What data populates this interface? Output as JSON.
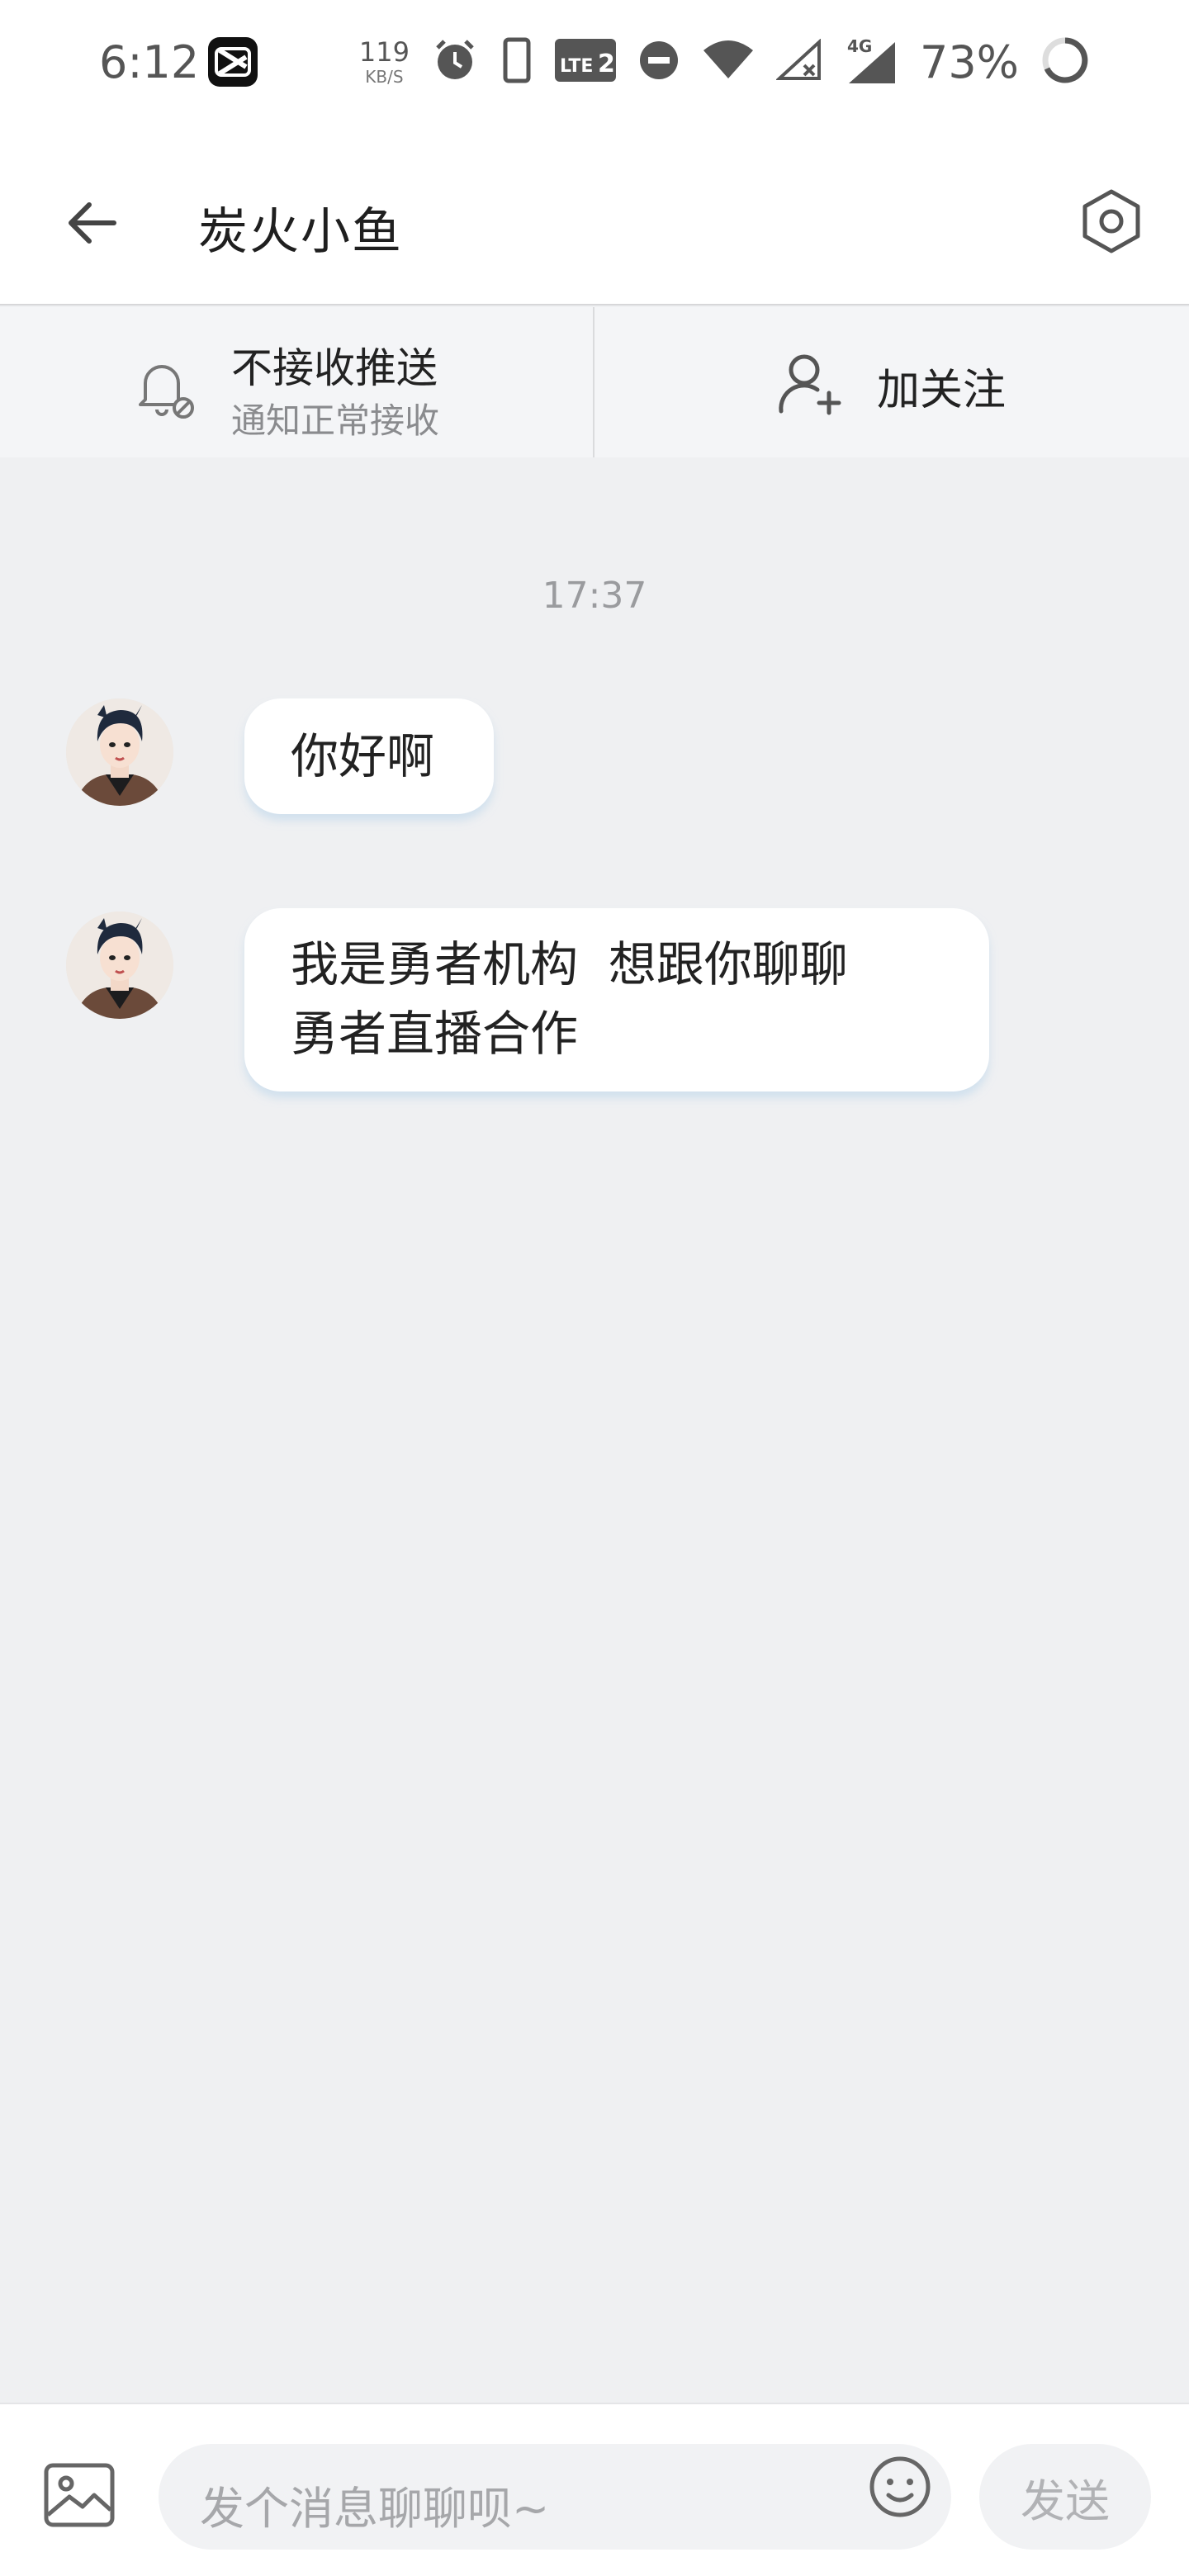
{
  "status_bar": {
    "time": "6:12",
    "net_speed_value": "119",
    "net_speed_unit": "KB/S",
    "volte_label": "LTE",
    "sim_slot": "2",
    "network_type": "4G",
    "battery_text": "73%",
    "icons": [
      "capcut-app-icon",
      "alarm-icon",
      "phone-icon",
      "volte-icon",
      "dnd-icon",
      "wifi-icon",
      "signal-no-service-icon",
      "signal-4g-icon",
      "battery-ring-icon"
    ]
  },
  "header": {
    "title": "炭火小鱼",
    "back_icon": "back-arrow-icon",
    "settings_icon": "settings-hexagon-icon"
  },
  "actions": {
    "notify_title": "不接收推送",
    "notify_subtitle": "通知正常接收",
    "follow_label": "加关注"
  },
  "chat": {
    "timestamp": "17:37",
    "messages": [
      {
        "text": "你好啊"
      },
      {
        "line1": "我是勇者机构  想跟你聊聊",
        "line2": "勇者直播合作"
      }
    ]
  },
  "composer": {
    "placeholder": "发个消息聊聊呗~",
    "send_label": "发送"
  },
  "colors": {
    "page_bg": "#eff0f2",
    "bubble_bg": "#ffffff",
    "bubble_shadow": "#bad6eb",
    "muted_text": "#9a9b9e"
  }
}
